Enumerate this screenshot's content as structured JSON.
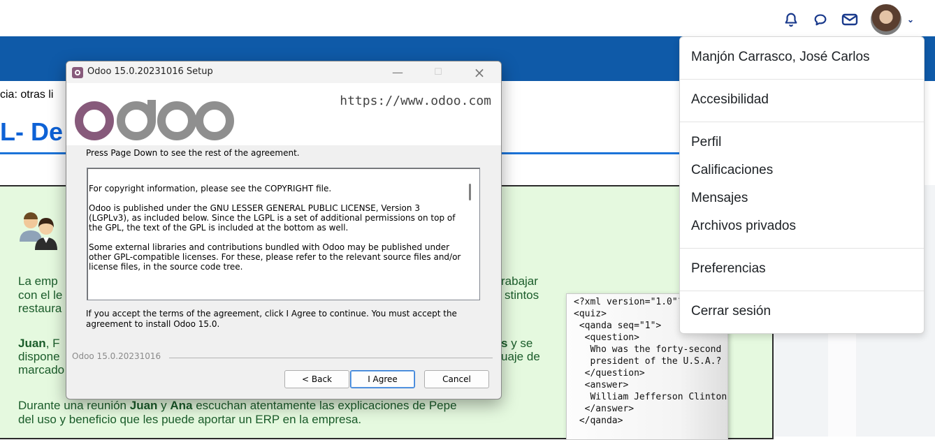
{
  "page": {
    "licencia_text": "cia: otras li",
    "heading_text": "L- De",
    "paragraphs": {
      "p1": "La emp",
      "p1_right": "rabajar",
      "p2": "con el le",
      "p2_right": "stintos",
      "p3": "restaura",
      "p4_a": "Juan",
      "p4_b": ", F",
      "p4_right_b": "s",
      "p4_right": " y se",
      "p5": "dispone",
      "p5_right": "uaje de",
      "p6": "marcado",
      "p7_a": "Durante una reunión ",
      "p7_b": "Juan",
      "p7_c": " y ",
      "p7_d": "Ana",
      "p7_e": " escuchan atentamente las explicaciones de Pepe",
      "p8": "del uso y beneficio que les puede aportar un ERP en la empresa."
    },
    "xml_code": "<?xml version=\"1.0\"?>\n<quiz>\n <qanda seq=\"1\">\n  <question>\n   Who was the forty-second\n   president of the U.S.A.?\n  </question>\n  <answer>\n   William Jefferson Clinton\n  </answer>\n </qanda>"
  },
  "topbar": {
    "icons": [
      "bell-icon",
      "chat-bubble-icon",
      "envelope-icon"
    ],
    "accent_color": "#1a3a8c"
  },
  "dialog": {
    "title": "Odoo 15.0.20231016 Setup",
    "url": "https://www.odoo.com",
    "logo_text": "odoo",
    "logo_colors": {
      "o1": "#875a7b",
      "rest": "#8f8f8f"
    },
    "instruction": "Press Page Down to see the rest of the agreement.",
    "license_paragraphs": [
      "For copyright information, please see the COPYRIGHT file.",
      "Odoo is published under the GNU LESSER GENERAL PUBLIC LICENSE, Version 3 (LGPLv3), as included below. Since the LGPL is a set of additional permissions on top of the GPL, the text of the GPL is included at the bottom as well.",
      "Some external libraries and contributions bundled with Odoo may be published under other GPL-compatible licenses. For these, please refer to the relevant source files and/or license files, in the source code tree."
    ],
    "accept_text": "If you accept the terms of the agreement, click I Agree to continue. You must accept the agreement to install Odoo 15.0.",
    "brand": "Odoo 15.0.20231016",
    "buttons": {
      "back": "< Back",
      "agree": "I Agree",
      "cancel": "Cancel"
    }
  },
  "user_menu": {
    "name": "Manjón Carrasco, José Carlos",
    "accessibility": "Accesibilidad",
    "profile": "Perfil",
    "grades": "Calificaciones",
    "messages": "Mensajes",
    "private_files": "Archivos privados",
    "preferences": "Preferencias",
    "logout": "Cerrar sesión"
  }
}
